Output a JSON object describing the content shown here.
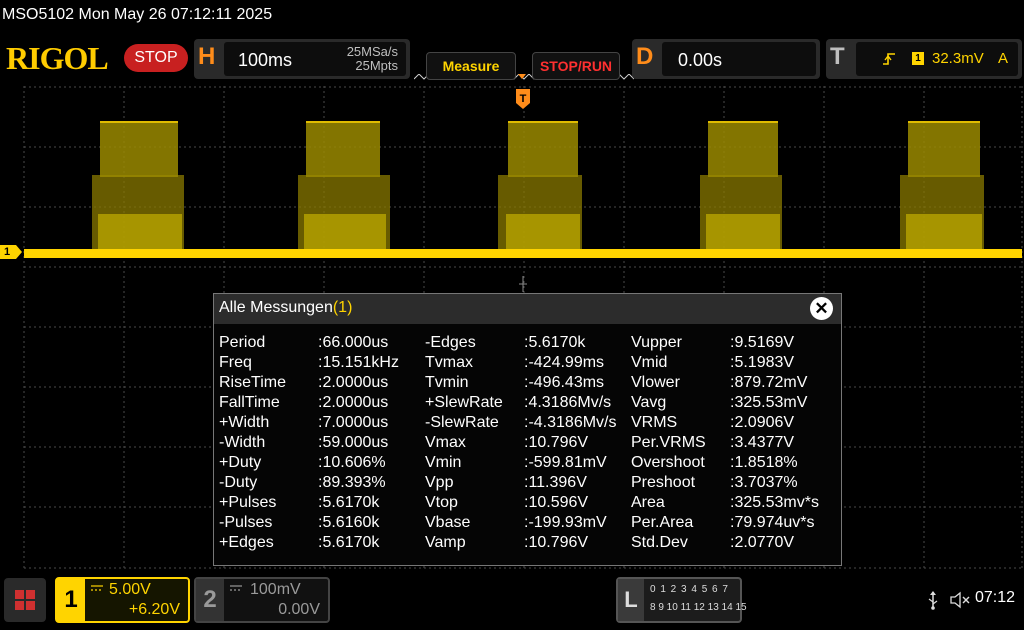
{
  "titlebar": {
    "text": "MSO5102  Mon May 26 07:12:11 2025"
  },
  "header": {
    "logo": "RIGOL",
    "run_state": "STOP",
    "horizontal": {
      "letter": "H",
      "timebase": "100ms",
      "sample_rate": "25MSa/s",
      "memory_depth": "25Mpts"
    },
    "buttons": {
      "measure": "Measure",
      "stop_run": "STOP/RUN"
    },
    "delay": {
      "letter": "D",
      "value": "0.00s"
    },
    "trigger": {
      "letter": "T",
      "source": "1",
      "level": "32.3mV",
      "mode": "A"
    }
  },
  "scope": {
    "ch1_marker": "1",
    "ch1_color": "#ffd400",
    "grid_color": "#4a4a4a",
    "icons": [
      "trigger-position-marker",
      "channel-1-ground-marker"
    ]
  },
  "measurements": {
    "title": "Alle Messungen",
    "count": "(1)",
    "close": "✕",
    "rows": [
      {
        "n1": "Period",
        "v1": ":66.000us",
        "n2": "-Edges",
        "v2": ":5.6170k",
        "n3": "Vupper",
        "v3": ":9.5169V"
      },
      {
        "n1": "Freq",
        "v1": ":15.151kHz",
        "n2": "Tvmax",
        "v2": ":-424.99ms",
        "n3": "Vmid",
        "v3": ":5.1983V"
      },
      {
        "n1": "RiseTime",
        "v1": ":2.0000us",
        "n2": "Tvmin",
        "v2": ":-496.43ms",
        "n3": "Vlower",
        "v3": ":879.72mV"
      },
      {
        "n1": "FallTime",
        "v1": ":2.0000us",
        "n2": "+SlewRate",
        "v2": ":4.3186Mv/s",
        "n3": "Vavg",
        "v3": ":325.53mV"
      },
      {
        "n1": "+Width",
        "v1": ":7.0000us",
        "n2": "-SlewRate",
        "v2": ":-4.3186Mv/s",
        "n3": "VRMS",
        "v3": ":2.0906V"
      },
      {
        "n1": "-Width",
        "v1": ":59.000us",
        "n2": "Vmax",
        "v2": ":10.796V",
        "n3": "Per.VRMS",
        "v3": ":3.4377V"
      },
      {
        "n1": "+Duty",
        "v1": ":10.606%",
        "n2": "Vmin",
        "v2": ":-599.81mV",
        "n3": "Overshoot",
        "v3": ":1.8518%"
      },
      {
        "n1": "-Duty",
        "v1": ":89.393%",
        "n2": "Vpp",
        "v2": ":11.396V",
        "n3": "Preshoot",
        "v3": ":3.7037%"
      },
      {
        "n1": "+Pulses",
        "v1": ":5.6170k",
        "n2": "Vtop",
        "v2": ":10.596V",
        "n3": "Area",
        "v3": ":325.53mv*s"
      },
      {
        "n1": "-Pulses",
        "v1": ":5.6160k",
        "n2": "Vbase",
        "v2": ":-199.93mV",
        "n3": "Per.Area",
        "v3": ":79.974uv*s"
      },
      {
        "n1": "+Edges",
        "v1": ":5.6170k",
        "n2": "Vamp",
        "v2": ":10.796V",
        "n3": "Std.Dev",
        "v3": ":2.0770V"
      }
    ]
  },
  "footer": {
    "ch1": {
      "number": "1",
      "scale": "5.00V",
      "offset": "+6.20V"
    },
    "ch2": {
      "number": "2",
      "scale": "100mV",
      "offset": "0.00V"
    },
    "logic": {
      "letter": "L",
      "row1": "0 1 2 3  4 5 6 7",
      "row2": "8 9 10 11 12 13 14 15"
    },
    "time": "07:12"
  }
}
